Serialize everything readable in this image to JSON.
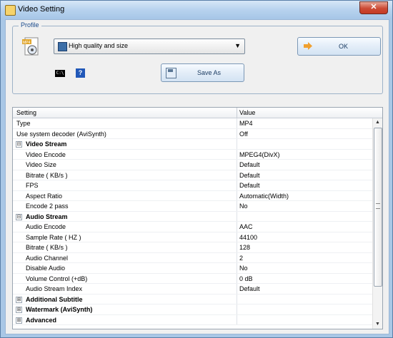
{
  "window": {
    "title": "Video Setting",
    "close_label": "✕"
  },
  "profile": {
    "legend": "Profile",
    "selected": "High quality and size",
    "cmd_label": "C:\\",
    "help_label": "?"
  },
  "buttons": {
    "ok": "OK",
    "save_as": "Save As"
  },
  "grid": {
    "headers": {
      "setting": "Setting",
      "value": "Value"
    },
    "rows": [
      {
        "name": "Type",
        "value": "MP4"
      },
      {
        "name": "Use system decoder (AviSynth)",
        "value": "Off"
      },
      {
        "name": "Video Stream",
        "value": ""
      },
      {
        "name": "Video Encode",
        "value": "MPEG4(DivX)"
      },
      {
        "name": "Video Size",
        "value": "Default"
      },
      {
        "name": "Bitrate ( KB/s )",
        "value": "Default"
      },
      {
        "name": "FPS",
        "value": "Default"
      },
      {
        "name": "Aspect Ratio",
        "value": "Automatic(Width)"
      },
      {
        "name": "Encode 2 pass",
        "value": "No"
      },
      {
        "name": "Audio Stream",
        "value": ""
      },
      {
        "name": "Audio Encode",
        "value": "AAC"
      },
      {
        "name": "Sample Rate ( HZ )",
        "value": "44100"
      },
      {
        "name": "Bitrate ( KB/s )",
        "value": "128"
      },
      {
        "name": "Audio Channel",
        "value": "2"
      },
      {
        "name": "Disable Audio",
        "value": "No"
      },
      {
        "name": "Volume Control (+dB)",
        "value": "0 dB"
      },
      {
        "name": "Audio Stream Index",
        "value": "Default"
      },
      {
        "name": "Additional Subtitle",
        "value": ""
      },
      {
        "name": "Watermark (AviSynth)",
        "value": ""
      },
      {
        "name": "Advanced",
        "value": ""
      }
    ]
  },
  "icons": {
    "expanded": "⊟",
    "collapsed": "⊞",
    "scroll_up": "▲",
    "scroll_down": "▼",
    "dropdown": "▼"
  },
  "colors": {
    "title_bg": "#b7d2ee",
    "close_bg": "#cc4b35",
    "legend_text": "#1a4b8c"
  }
}
